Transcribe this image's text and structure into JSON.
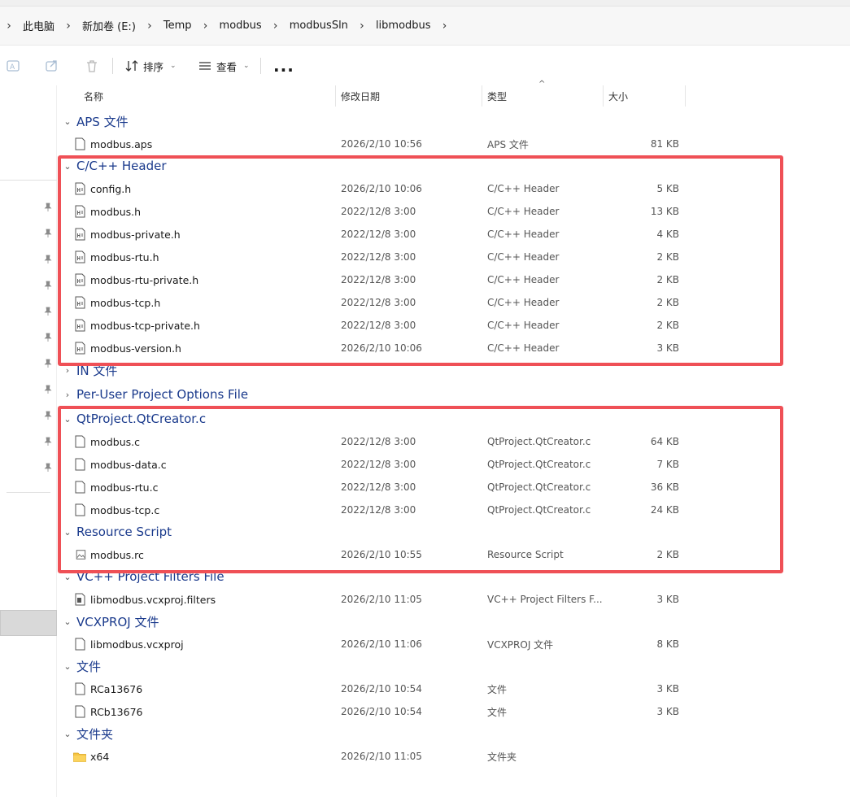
{
  "breadcrumb": {
    "items": [
      "此电脑",
      "新加卷 (E:)",
      "Temp",
      "modbus",
      "modbusSln",
      "libmodbus"
    ]
  },
  "toolbar": {
    "sort_label": "排序",
    "view_label": "查看",
    "more_label": "..."
  },
  "columns": {
    "name": "名称",
    "date": "修改日期",
    "type": "类型",
    "size": "大小"
  },
  "groups": [
    {
      "label": "APS 文件",
      "expanded": true,
      "files": [
        {
          "name": "modbus.aps",
          "date": "2026/2/10 10:56",
          "type": "APS 文件",
          "size": "81 KB",
          "icon": "blank-file-icon"
        }
      ]
    },
    {
      "label": "C/C++ Header",
      "expanded": true,
      "files": [
        {
          "name": "config.h",
          "date": "2026/2/10 10:06",
          "type": "C/C++ Header",
          "size": "5 KB",
          "icon": "header-file-icon"
        },
        {
          "name": "modbus.h",
          "date": "2022/12/8 3:00",
          "type": "C/C++ Header",
          "size": "13 KB",
          "icon": "header-file-icon"
        },
        {
          "name": "modbus-private.h",
          "date": "2022/12/8 3:00",
          "type": "C/C++ Header",
          "size": "4 KB",
          "icon": "header-file-icon"
        },
        {
          "name": "modbus-rtu.h",
          "date": "2022/12/8 3:00",
          "type": "C/C++ Header",
          "size": "2 KB",
          "icon": "header-file-icon"
        },
        {
          "name": "modbus-rtu-private.h",
          "date": "2022/12/8 3:00",
          "type": "C/C++ Header",
          "size": "2 KB",
          "icon": "header-file-icon"
        },
        {
          "name": "modbus-tcp.h",
          "date": "2022/12/8 3:00",
          "type": "C/C++ Header",
          "size": "2 KB",
          "icon": "header-file-icon"
        },
        {
          "name": "modbus-tcp-private.h",
          "date": "2022/12/8 3:00",
          "type": "C/C++ Header",
          "size": "2 KB",
          "icon": "header-file-icon"
        },
        {
          "name": "modbus-version.h",
          "date": "2026/2/10 10:06",
          "type": "C/C++ Header",
          "size": "3 KB",
          "icon": "header-file-icon"
        }
      ]
    },
    {
      "label": "IN 文件",
      "expanded": false,
      "files": []
    },
    {
      "label": "Per-User Project Options File",
      "expanded": false,
      "files": []
    },
    {
      "label": "QtProject.QtCreator.c",
      "expanded": true,
      "files": [
        {
          "name": "modbus.c",
          "date": "2022/12/8 3:00",
          "type": "QtProject.QtCreator.c",
          "size": "64 KB",
          "icon": "blank-file-icon"
        },
        {
          "name": "modbus-data.c",
          "date": "2022/12/8 3:00",
          "type": "QtProject.QtCreator.c",
          "size": "7 KB",
          "icon": "blank-file-icon"
        },
        {
          "name": "modbus-rtu.c",
          "date": "2022/12/8 3:00",
          "type": "QtProject.QtCreator.c",
          "size": "36 KB",
          "icon": "blank-file-icon"
        },
        {
          "name": "modbus-tcp.c",
          "date": "2022/12/8 3:00",
          "type": "QtProject.QtCreator.c",
          "size": "24 KB",
          "icon": "blank-file-icon"
        }
      ]
    },
    {
      "label": "Resource Script",
      "expanded": true,
      "files": [
        {
          "name": "modbus.rc",
          "date": "2026/2/10 10:55",
          "type": "Resource Script",
          "size": "2 KB",
          "icon": "image-file-icon"
        }
      ]
    },
    {
      "label": "VC++ Project Filters File",
      "expanded": true,
      "files": [
        {
          "name": "libmodbus.vcxproj.filters",
          "date": "2026/2/10 11:05",
          "type": "VC++ Project Filters F...",
          "size": "3 KB",
          "icon": "filters-file-icon"
        }
      ]
    },
    {
      "label": "VCXPROJ 文件",
      "expanded": true,
      "files": [
        {
          "name": "libmodbus.vcxproj",
          "date": "2026/2/10 11:06",
          "type": "VCXPROJ 文件",
          "size": "8 KB",
          "icon": "blank-file-icon"
        }
      ]
    },
    {
      "label": "文件",
      "expanded": true,
      "files": [
        {
          "name": "RCa13676",
          "date": "2026/2/10 10:54",
          "type": "文件",
          "size": "3 KB",
          "icon": "blank-file-icon"
        },
        {
          "name": "RCb13676",
          "date": "2026/2/10 10:54",
          "type": "文件",
          "size": "3 KB",
          "icon": "blank-file-icon"
        }
      ]
    },
    {
      "label": "文件夹",
      "expanded": true,
      "files": [
        {
          "name": "x64",
          "date": "2026/2/10 11:05",
          "type": "文件夹",
          "size": "",
          "icon": "folder-icon"
        }
      ]
    }
  ],
  "colors": {
    "group_label": "#1a3a8c",
    "highlight": "#ef5056"
  }
}
